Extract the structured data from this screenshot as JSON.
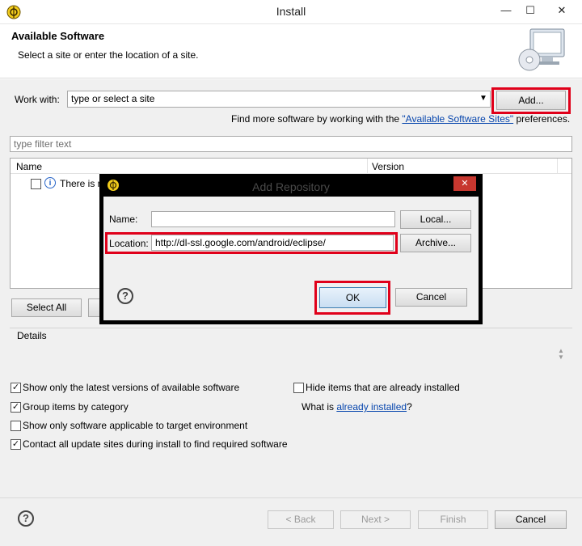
{
  "window": {
    "title": "Install",
    "minimize_glyph": "—",
    "maximize_glyph": "☐",
    "close_glyph": "✕"
  },
  "header": {
    "title": "Available Software",
    "subtitle": "Select a site or enter the location of a site."
  },
  "work_with": {
    "label": "Work with:",
    "placeholder": "type or select a site",
    "add_button": "Add...",
    "find_more_prefix": "Find more software by working with the ",
    "find_more_link": "\"Available Software Sites\"",
    "find_more_suffix": " preferences."
  },
  "filter": {
    "placeholder": "type filter text"
  },
  "table": {
    "columns": [
      "Name",
      "Version"
    ],
    "rows": [
      {
        "text": "There is n"
      }
    ]
  },
  "buttons": {
    "select_all": "Select All"
  },
  "details": {
    "label": "Details"
  },
  "options": {
    "left": [
      {
        "label": "Show only the latest versions of available software",
        "checked": true
      },
      {
        "label": "Group items by category",
        "checked": true
      },
      {
        "label": "Show only software applicable to target environment",
        "checked": false
      },
      {
        "label": "Contact all update sites during install to find required software",
        "checked": true
      }
    ],
    "hide_installed": {
      "label": "Hide items that are already installed",
      "checked": false
    },
    "what_is_prefix": "What is ",
    "what_is_link": "already installed",
    "what_is_suffix": "?"
  },
  "footer": {
    "back": "< Back",
    "next": "Next >",
    "finish": "Finish",
    "cancel": "Cancel"
  },
  "dialog": {
    "title": "Add Repository",
    "close_glyph": "✕",
    "name_label": "Name:",
    "name_value": "",
    "location_label": "Location:",
    "location_value": "http://dl-ssl.google.com/android/eclipse/",
    "local_button": "Local...",
    "archive_button": "Archive...",
    "ok_button": "OK",
    "cancel_button": "Cancel"
  },
  "colors": {
    "highlight_red": "#e0001a",
    "eclipse_green": "#e8c01c",
    "link_blue": "#0645ad"
  }
}
